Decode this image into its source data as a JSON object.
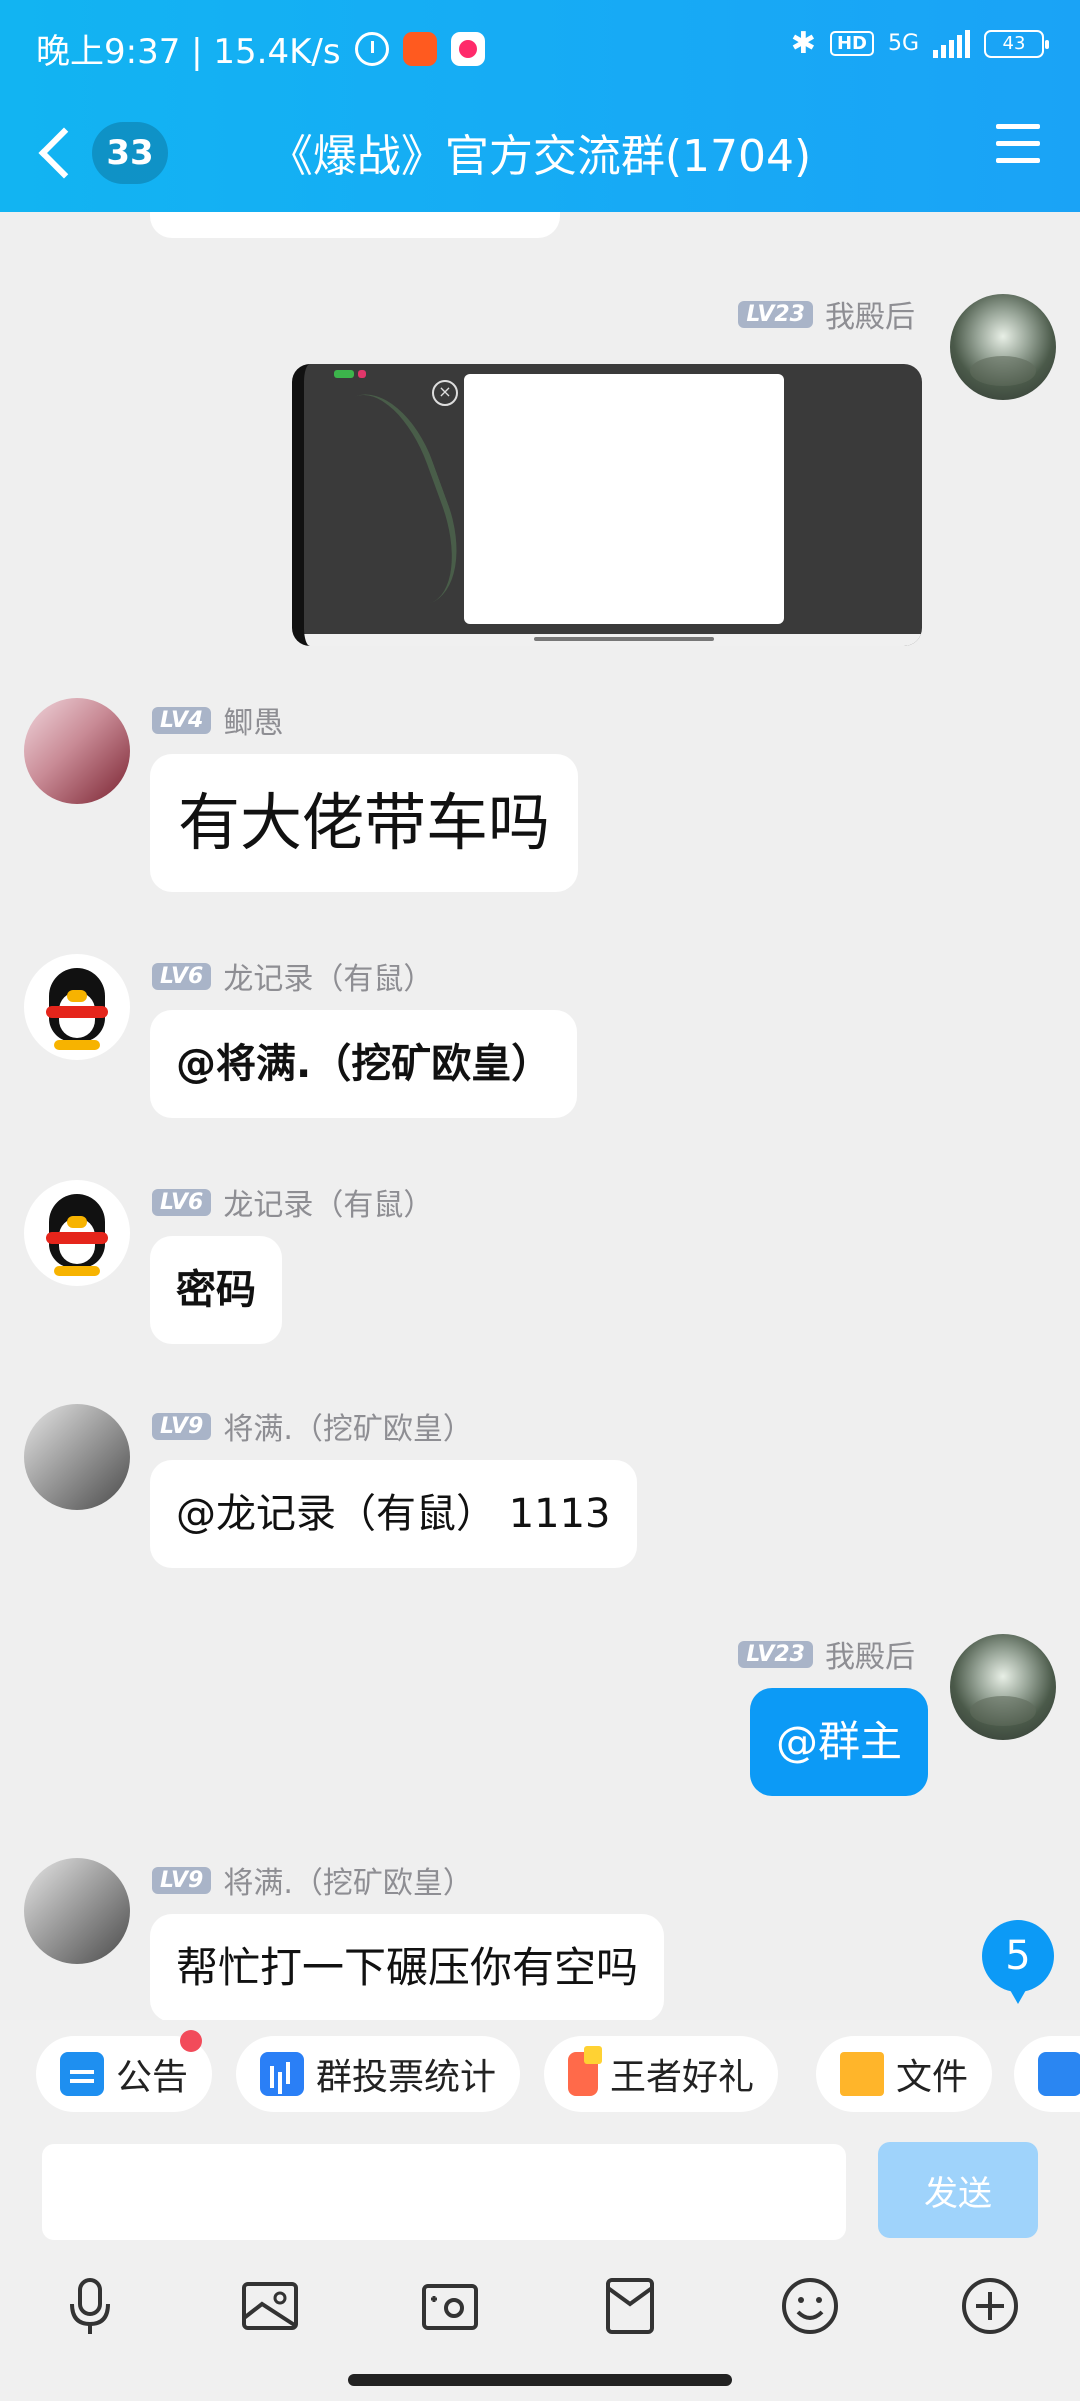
{
  "status_bar": {
    "time_speed": "晚上9:37 | 15.4K/s",
    "bluetooth": "✱",
    "hd": "HD",
    "network": "5G",
    "battery": "43"
  },
  "header": {
    "back_count": "33",
    "title": "《爆战》官方交流群(1704)"
  },
  "messages": [
    {
      "side": "right",
      "level": "LV23",
      "name": "我殿后",
      "type": "image"
    },
    {
      "side": "left",
      "level": "LV4",
      "name": "鲫愚",
      "text": "有大佬带车吗"
    },
    {
      "side": "left",
      "level": "LV6",
      "name": "龙记录（有鼠）",
      "text": "@将满.（挖矿欧皇）"
    },
    {
      "side": "left",
      "level": "LV6",
      "name": "龙记录（有鼠）",
      "text": "密码"
    },
    {
      "side": "left",
      "level": "LV9",
      "name": "将满.（挖矿欧皇）",
      "text": "@龙记录（有鼠） 1113"
    },
    {
      "side": "right",
      "level": "LV23",
      "name": "我殿后",
      "text": "@群主"
    },
    {
      "side": "left",
      "level": "LV9",
      "name": "将满.（挖矿欧皇）",
      "text": "帮忙打一下碾压你有空吗"
    }
  ],
  "unread_count": "5",
  "quick_bar": [
    "公告",
    "群投票统计",
    "王者好礼",
    "文件"
  ],
  "input": {
    "placeholder": "",
    "value": ""
  },
  "send_label": "发送",
  "colors": {
    "header": "#17aaf5",
    "bubble_self": "#0c9af6",
    "background": "#efefef"
  }
}
